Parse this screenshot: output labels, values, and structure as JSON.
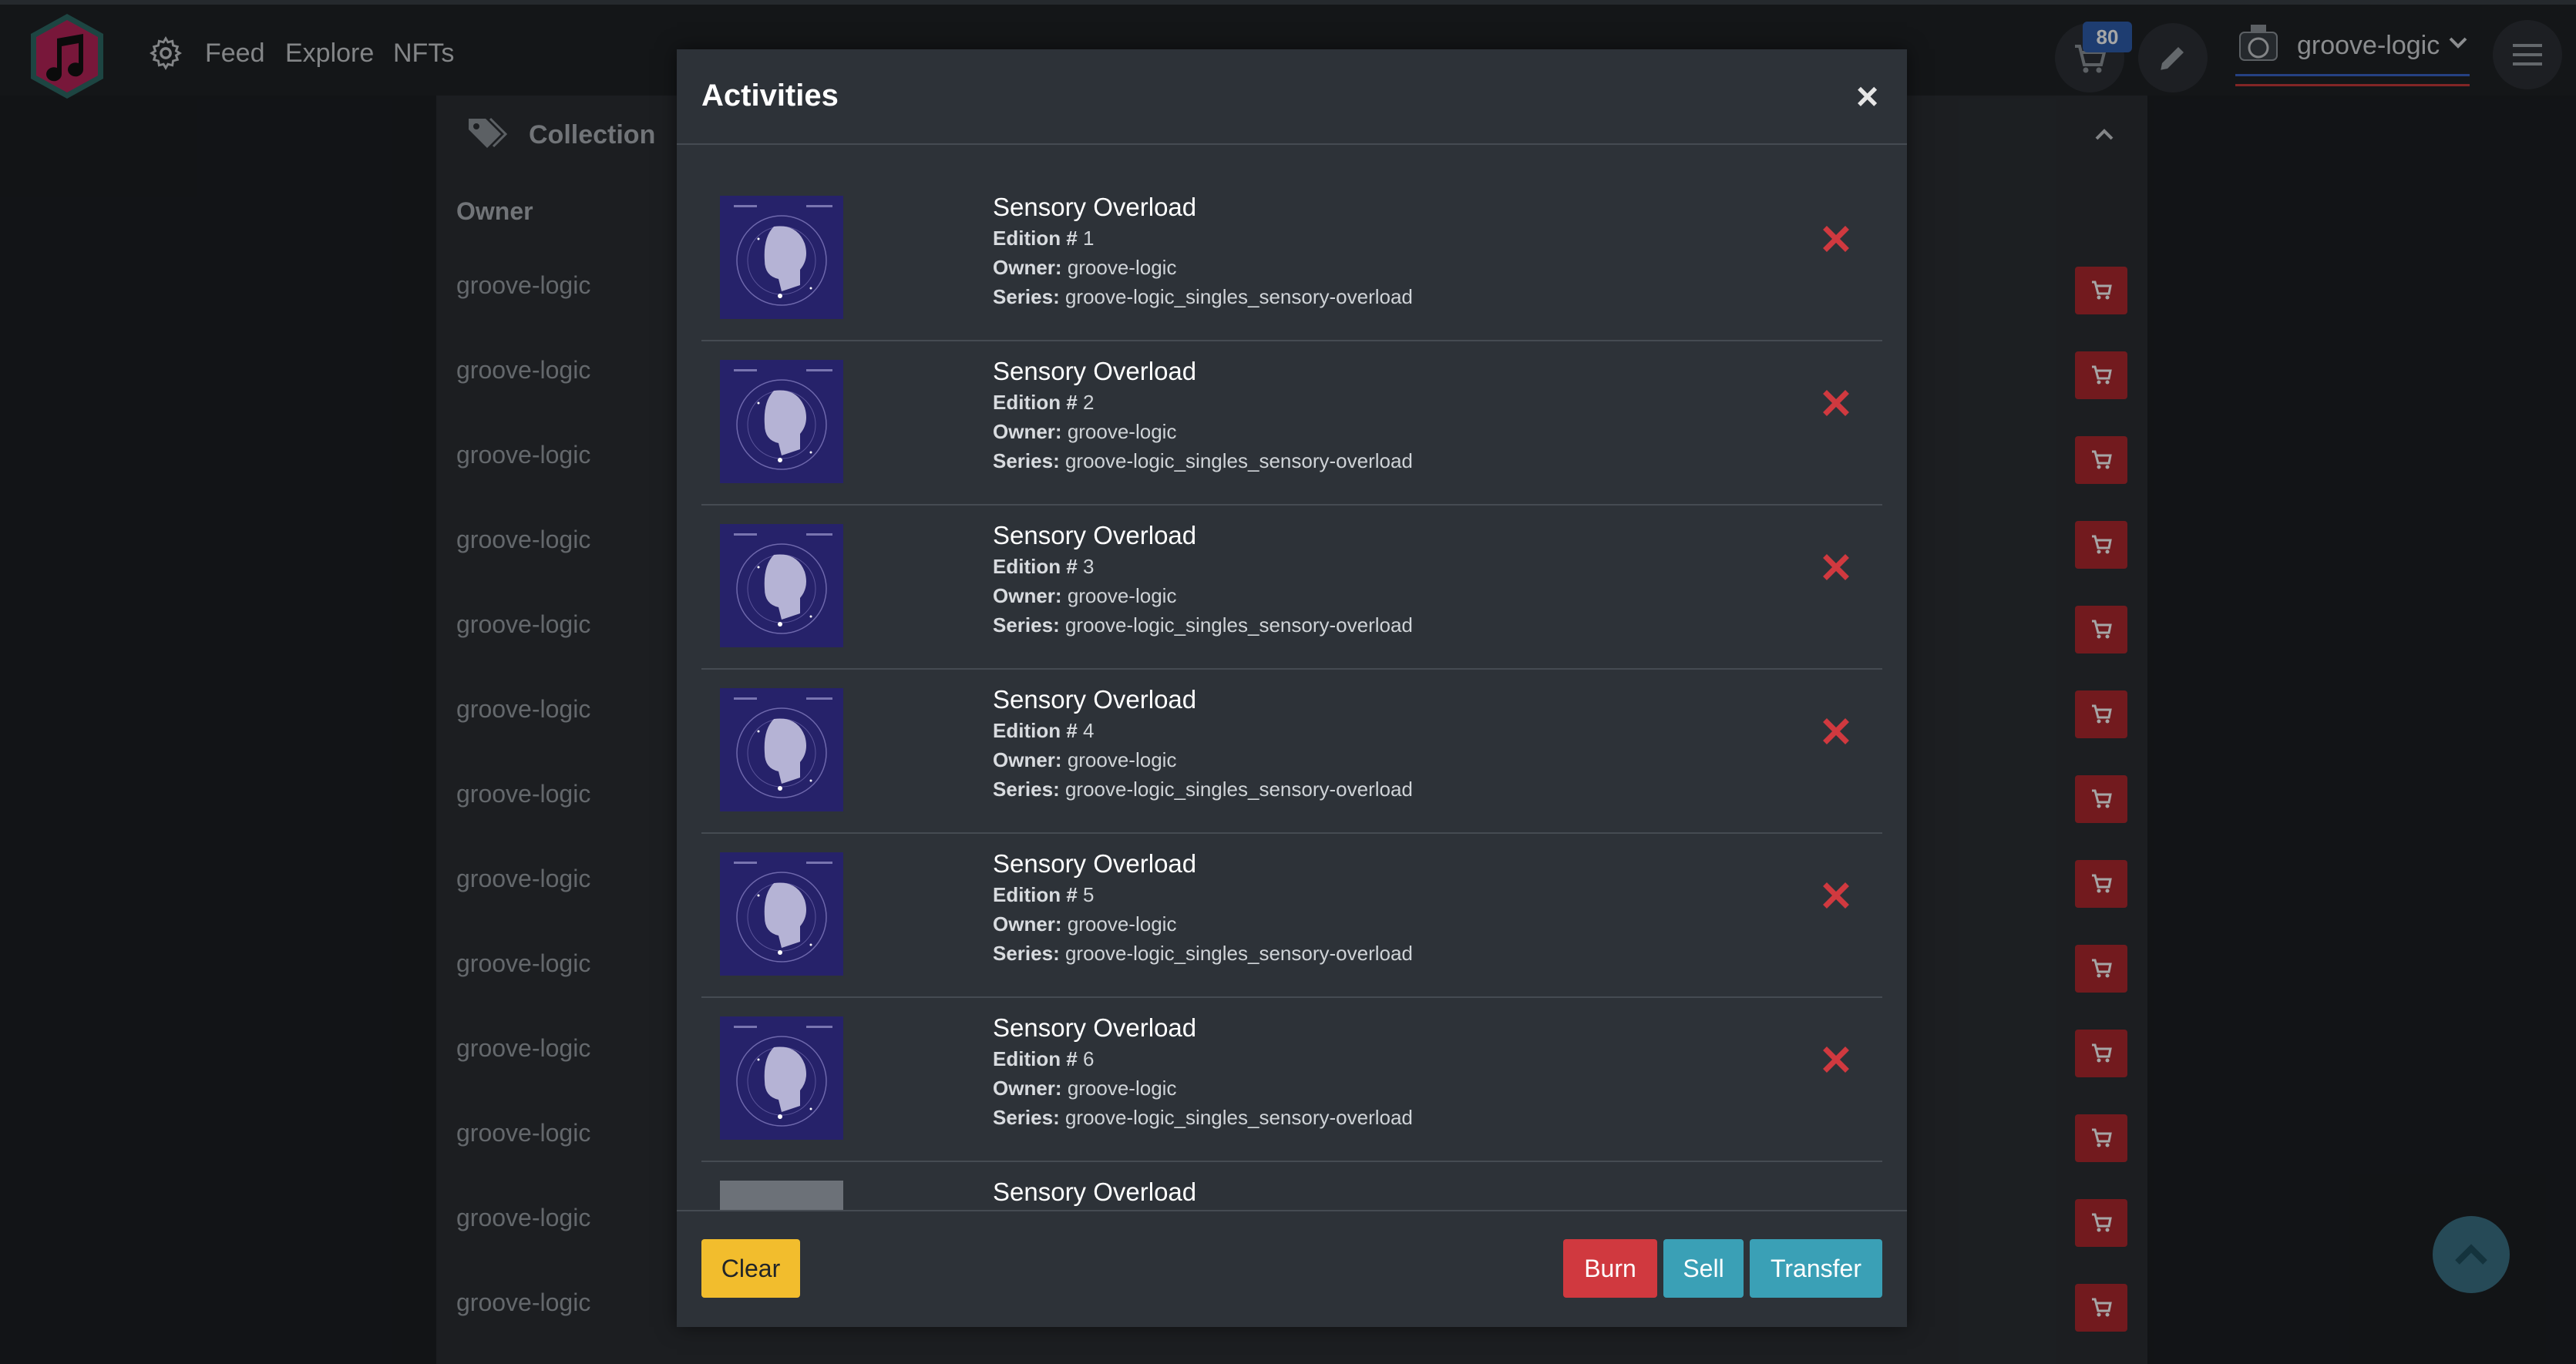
{
  "nav": {
    "links": [
      "Feed",
      "Explore",
      "NFTs"
    ],
    "cart_count": "80",
    "username": "groove-logic"
  },
  "background": {
    "collection_title": "Collection",
    "owner_header": "Owner",
    "owners": [
      "groove-logic",
      "groove-logic",
      "groove-logic",
      "groove-logic",
      "groove-logic",
      "groove-logic",
      "groove-logic",
      "groove-logic",
      "groove-logic",
      "groove-logic",
      "groove-logic",
      "groove-logic",
      "groove-logic"
    ]
  },
  "modal": {
    "title": "Activities",
    "labels": {
      "edition": "Edition #",
      "owner": "Owner:",
      "series": "Series:"
    },
    "items": [
      {
        "title": "Sensory Overload",
        "edition": "1",
        "owner": "groove-logic",
        "series": "groove-logic_singles_sensory-overload"
      },
      {
        "title": "Sensory Overload",
        "edition": "2",
        "owner": "groove-logic",
        "series": "groove-logic_singles_sensory-overload"
      },
      {
        "title": "Sensory Overload",
        "edition": "3",
        "owner": "groove-logic",
        "series": "groove-logic_singles_sensory-overload"
      },
      {
        "title": "Sensory Overload",
        "edition": "4",
        "owner": "groove-logic",
        "series": "groove-logic_singles_sensory-overload"
      },
      {
        "title": "Sensory Overload",
        "edition": "5",
        "owner": "groove-logic",
        "series": "groove-logic_singles_sensory-overload"
      },
      {
        "title": "Sensory Overload",
        "edition": "6",
        "owner": "groove-logic",
        "series": "groove-logic_singles_sensory-overload"
      },
      {
        "title": "Sensory Overload"
      }
    ],
    "buttons": {
      "clear": "Clear",
      "burn": "Burn",
      "sell": "Sell",
      "transfer": "Transfer"
    }
  },
  "colors": {
    "accent_red": "#d0393f",
    "accent_teal": "#3aa0b6",
    "accent_yellow": "#f2bd2d",
    "cart_red": "#b0292f",
    "logo_pink": "#b8245a"
  },
  "icons": [
    "music-logo-icon",
    "gear-icon",
    "cart-icon",
    "pencil-icon",
    "avatar-icon",
    "chevron-down-icon",
    "menu-icon",
    "tag-icon",
    "chevron-up-icon",
    "close-icon",
    "remove-x-icon",
    "scroll-top-icon"
  ]
}
